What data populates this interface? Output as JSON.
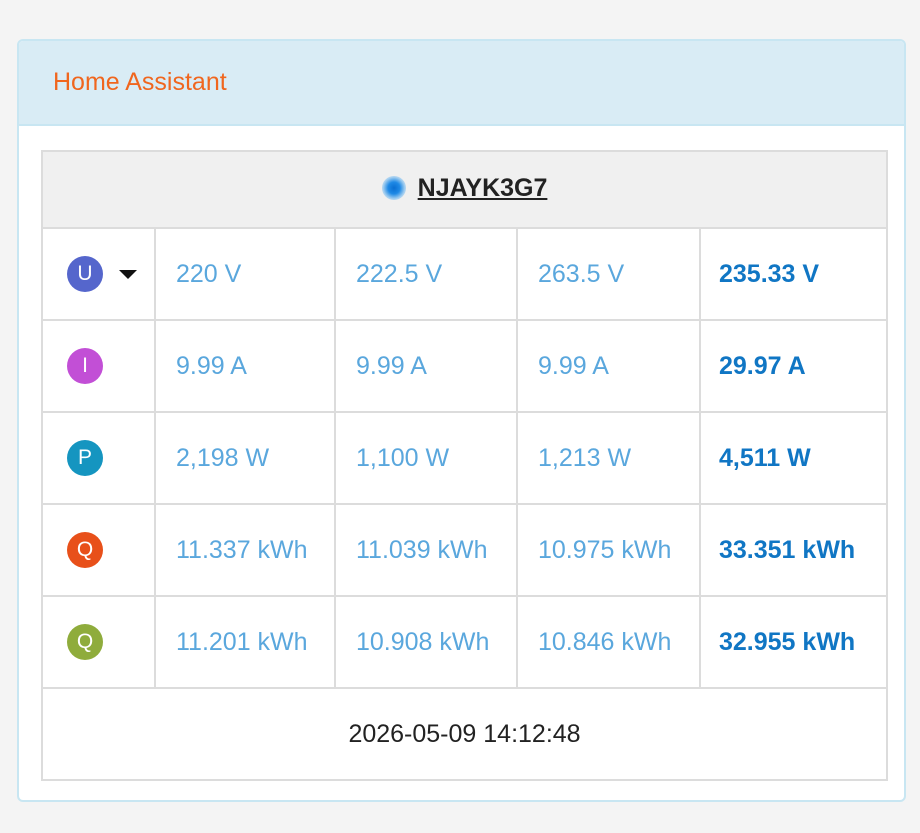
{
  "header": {
    "title": "Home Assistant"
  },
  "device": {
    "name": "NJAYK3G7",
    "status_color": "#0a6ed1"
  },
  "rows": [
    {
      "symbol": "U",
      "icon": "voltage-icon",
      "color": "#5566cc",
      "has_dropdown": true,
      "values": [
        "220 V",
        "222.5 V",
        "263.5 V"
      ],
      "total": "235.33 V"
    },
    {
      "symbol": "I",
      "icon": "current-icon",
      "color": "#c24fd6",
      "has_dropdown": false,
      "values": [
        "9.99 A",
        "9.99 A",
        "9.99 A"
      ],
      "total": "29.97 A"
    },
    {
      "symbol": "P",
      "icon": "power-icon",
      "color": "#1595c0",
      "has_dropdown": false,
      "values": [
        "2,198 W",
        "1,100 W",
        "1,213 W"
      ],
      "total": "4,511 W"
    },
    {
      "symbol": "Q",
      "icon": "energy-import-icon",
      "color": "#e8501a",
      "has_dropdown": false,
      "values": [
        "11.337 kWh",
        "11.039 kWh",
        "10.975 kWh"
      ],
      "total": "33.351 kWh"
    },
    {
      "symbol": "Q",
      "icon": "energy-export-icon",
      "color": "#8fac3c",
      "has_dropdown": false,
      "values": [
        "11.201 kWh",
        "10.908 kWh",
        "10.846 kWh"
      ],
      "total": "32.955 kWh"
    }
  ],
  "footer": {
    "timestamp": "2026-05-09 14:12:48"
  },
  "colors": {
    "title": "#f0661e",
    "value": "#5aa7dd",
    "total": "#1076c4"
  }
}
